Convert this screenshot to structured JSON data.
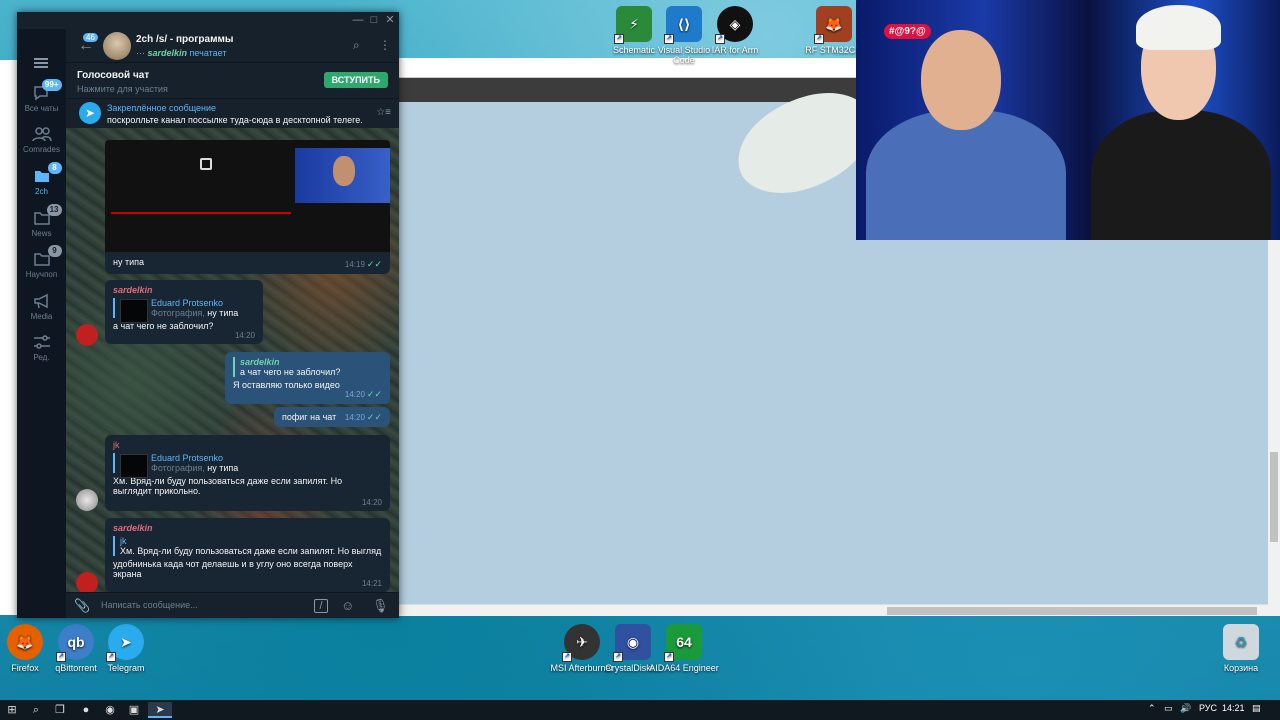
{
  "desktop": {
    "top_icons": [
      {
        "label": "Schematic",
        "color": "#2a8a3a"
      },
      {
        "label": "Visual Studio Code",
        "color": "#1f7acc"
      },
      {
        "label": "IAR for Arm",
        "color": "#111111"
      },
      {
        "label": "RF STM32C...",
        "color": "#a04020"
      }
    ],
    "bottom_icons": [
      {
        "label": "Firefox",
        "color": "#e66000"
      },
      {
        "label": "qBittorrent",
        "color": "#3d7ec8"
      },
      {
        "label": "Telegram",
        "color": "#2aabee"
      },
      {
        "label": "MSI Afterburner",
        "color": "#333333"
      },
      {
        "label": "CrystalDiskI...",
        "color": "#3050a0"
      },
      {
        "label": "AIDA64 Engineer",
        "color": "#1a9a3a"
      },
      {
        "label": "Корзина",
        "color": "#cfd8dc"
      }
    ]
  },
  "video": {
    "channel_logo": "#@9?@"
  },
  "telegram": {
    "side": {
      "all_chats": {
        "label": "Все чаты",
        "badge": "99+"
      },
      "comrades": {
        "label": "Comrades"
      },
      "folder_2ch": {
        "label": "2ch",
        "badge": "8"
      },
      "news": {
        "label": "News",
        "badge": "13"
      },
      "nauchpop": {
        "label": "Научпоп",
        "badge": "9"
      },
      "media": {
        "label": "Media"
      },
      "edit": {
        "label": "Ред."
      }
    },
    "header": {
      "unread": "46",
      "title": "2ch /s/ - программы",
      "typing_user": "sardelkin",
      "typing_text": "печатает"
    },
    "voice_chat": {
      "title": "Голосовой чат",
      "subtitle": "Нажмите для участия",
      "join_label": "ВСТУПИТЬ"
    },
    "pinned": {
      "label": "Закреплённое сообщение",
      "text": "поскролльте канал поссылке туда-сюда в десктопной телеге..."
    },
    "messages": [
      {
        "text": "ну типа",
        "time": "14:19",
        "checks": "✓✓"
      },
      {
        "author": "sardelkin",
        "reply_name": "Eduard Protsenko",
        "reply_prefix": "Фотография,",
        "reply_text": "ну типа",
        "text": "а чат чего не заблочил?",
        "time": "14:20"
      },
      {
        "reply_name": "sardelkin",
        "reply_text": "а чат чего не заблочил?",
        "text": "Я оставляю только видео",
        "time": "14:20",
        "checks": "✓✓"
      },
      {
        "text": "пофиг на чат",
        "time": "14:20",
        "checks": "✓✓"
      },
      {
        "author": "jk",
        "reply_name": "Eduard Protsenko",
        "reply_prefix": "Фотография,",
        "reply_text": "ну типа",
        "text": "Хм. Вряд-ли буду пользоваться даже если запилят. Но выглядит прикольно.",
        "time": "14:20"
      },
      {
        "author": "sardelkin",
        "reply_name": "jk",
        "reply_text": "Хм. Вряд-ли буду пользоваться даже если запилят. Но выгляд...",
        "text": "удобнинька када чот делаешь и в углу оно всегда поверх экрана",
        "time": "14:21"
      }
    ],
    "composer": {
      "placeholder": "Написать сообщение..."
    }
  },
  "taskbar": {
    "lang": "РУС",
    "time": "14:21"
  }
}
